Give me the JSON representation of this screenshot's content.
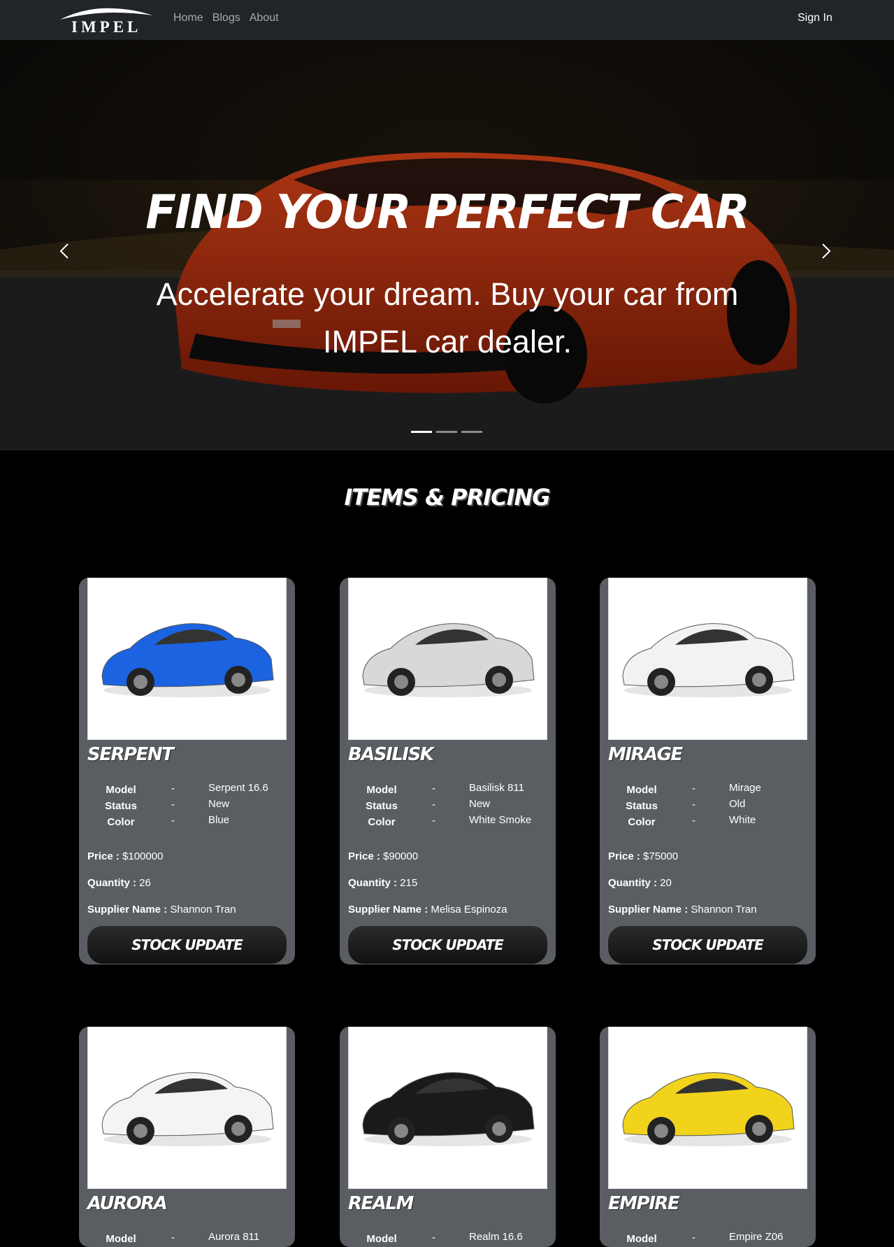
{
  "nav": {
    "logo_text": "IMPEL",
    "links": [
      "Home",
      "Blogs",
      "About"
    ],
    "signin": "Sign In"
  },
  "hero": {
    "title": "FIND YOUR PERFECT CAR",
    "subtitle": "Accelerate your dream. Buy your car from IMPEL car dealer.",
    "slides": 3,
    "active_slide": 1
  },
  "section": {
    "title": "ITEMS & PRICING"
  },
  "labels": {
    "model": "Model",
    "status": "Status",
    "color": "Color",
    "dash": "-",
    "price": "Price :",
    "quantity": "Quantity :",
    "supplier": "Supplier Name :",
    "stock_update": "STOCK UPDATE"
  },
  "cards": [
    {
      "name": "SERPENT",
      "model": "Serpent 16.6",
      "status": "New",
      "color": "Blue",
      "price": "$100000",
      "quantity": "26",
      "supplier": "Shannon Tran",
      "car_color": "#1b63e0"
    },
    {
      "name": "BASILISK",
      "model": "Basilisk 811",
      "status": "New",
      "color": "White Smoke",
      "price": "$90000",
      "quantity": "215",
      "supplier": "Melisa Espinoza",
      "car_color": "#d8d8d8"
    },
    {
      "name": "MIRAGE",
      "model": "Mirage",
      "status": "Old",
      "color": "White",
      "price": "$75000",
      "quantity": "20",
      "supplier": "Shannon Tran",
      "car_color": "#f2f2f2"
    },
    {
      "name": "AURORA",
      "model": "Aurora 811",
      "car_color": "#f4f4f4"
    },
    {
      "name": "REALM",
      "model": "Realm 16.6",
      "car_color": "#1a1a1a"
    },
    {
      "name": "EMPIRE",
      "model": "Empire Z06",
      "car_color": "#f2d31c"
    }
  ]
}
